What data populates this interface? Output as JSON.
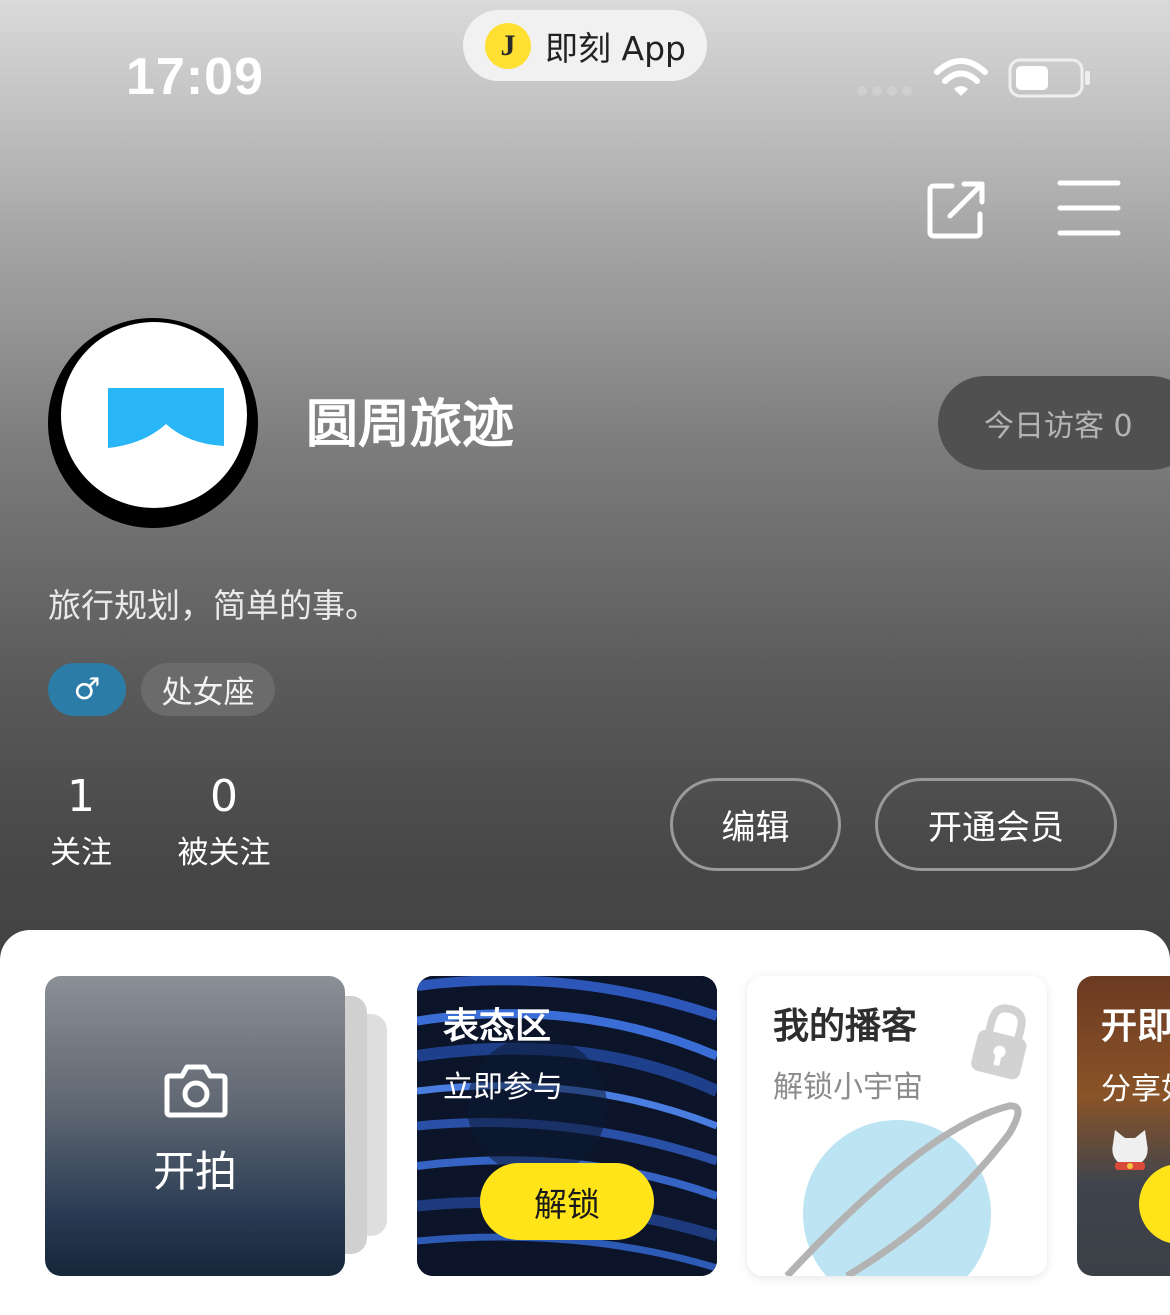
{
  "status_bar": {
    "time": "17:09",
    "app_pill_label": "即刻 App",
    "app_pill_icon": "J"
  },
  "profile": {
    "name": "圆周旅迹",
    "visitors": "今日访客 0",
    "bio": "旅行规划，简单的事。",
    "gender_symbol": "♂",
    "zodiac": "处女座",
    "following_count": "1",
    "following_label": "关注",
    "followers_count": "0",
    "followers_label": "被关注",
    "edit_label": "编辑",
    "vip_label": "开通会员"
  },
  "cards": {
    "camera_label": "开拍",
    "stance_title": "表态区",
    "stance_sub": "立即参与",
    "stance_button": "解锁",
    "podcast_title": "我的播客",
    "podcast_sub": "解锁小宇宙",
    "partial_title": "开即",
    "partial_sub": "分享如"
  },
  "colors": {
    "accent_yellow": "#ffe41a",
    "gender_tag": "#2c7ca8",
    "avatar_logo_blue": "#29b6f6"
  },
  "icons": [
    "share-icon",
    "menu-icon",
    "wifi-icon",
    "battery-icon",
    "camera-icon",
    "lock-icon",
    "planet-icon",
    "cat-icon"
  ]
}
